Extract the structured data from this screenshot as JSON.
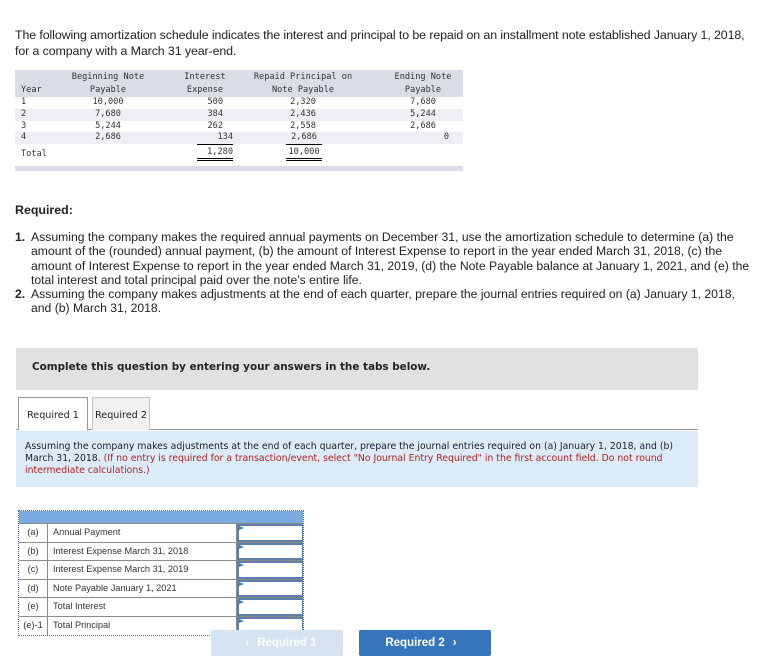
{
  "intro": "The following amortization schedule indicates the interest and principal to be repaid on an installment note established January 1, 2018, for a company with a March 31 year-end.",
  "schedule": {
    "headers": {
      "year": "Year",
      "beginning_l1": "Beginning Note",
      "beginning_l2": "Payable",
      "interest_l1": "Interest",
      "interest_l2": "Expense",
      "repaid_l1": "Repaid Principal on",
      "repaid_l2": "Note Payable",
      "ending_l1": "Ending Note",
      "ending_l2": "Payable"
    },
    "rows": [
      {
        "year": "1",
        "beginning": "10,000",
        "interest": "500",
        "repaid": "2,320",
        "ending": "7,680"
      },
      {
        "year": "2",
        "beginning": "7,680",
        "interest": "384",
        "repaid": "2,436",
        "ending": "5,244"
      },
      {
        "year": "3",
        "beginning": "5,244",
        "interest": "262",
        "repaid": "2,558",
        "ending": "2,686"
      },
      {
        "year": "4",
        "beginning": "2,686",
        "interest": "134",
        "repaid": "2,686",
        "ending": "0"
      }
    ],
    "total": {
      "label": "Total",
      "interest": "1,280",
      "repaid": "10,000"
    }
  },
  "required": {
    "title": "Required:",
    "items": [
      {
        "num": "1.",
        "text": "Assuming the company makes the required annual payments on December 31, use the amortization schedule to determine (a) the amount of the (rounded) annual payment, (b) the amount of Interest Expense to report in the year ended March 31, 2018, (c) the amount of Interest Expense to report in the year ended March 31, 2019, (d) the Note Payable balance at January 1, 2021, and (e) the total interest and total principal paid over the note's entire life."
      },
      {
        "num": "2.",
        "text": "Assuming the company makes adjustments at the end of each quarter, prepare the journal entries required on (a) January 1, 2018, and (b) March 31, 2018."
      }
    ]
  },
  "instruction": "Complete this question by entering your answers in the tabs below.",
  "tabs": [
    {
      "label": "Required 1",
      "active": true
    },
    {
      "label": "Required 2",
      "active": false
    }
  ],
  "note": {
    "main": "Assuming the company makes adjustments at the end of each quarter, prepare the journal entries required on (a) January 1, 2018, and (b) March 31, 2018.",
    "red": "(If no entry is required for a transaction/event, select \"No Journal Entry Required\" in the first account field. Do not round intermediate calculations.)"
  },
  "answers": [
    {
      "label": "(a)",
      "desc": "Annual Payment",
      "value": ""
    },
    {
      "label": "(b)",
      "desc": "Interest Expense March 31, 2018",
      "value": ""
    },
    {
      "label": "(c)",
      "desc": "Interest Expense March 31, 2019",
      "value": ""
    },
    {
      "label": "(d)",
      "desc": "Note Payable January 1, 2021",
      "value": ""
    },
    {
      "label": "(e)",
      "desc": "Total Interest",
      "value": ""
    },
    {
      "label": "(e)-1",
      "desc": "Total Principal",
      "value": ""
    }
  ],
  "nav": {
    "prev_label": "Required 1",
    "next_label": "Required 2",
    "prev_icon": "chevron-left-icon",
    "next_icon": "chevron-right-icon"
  }
}
